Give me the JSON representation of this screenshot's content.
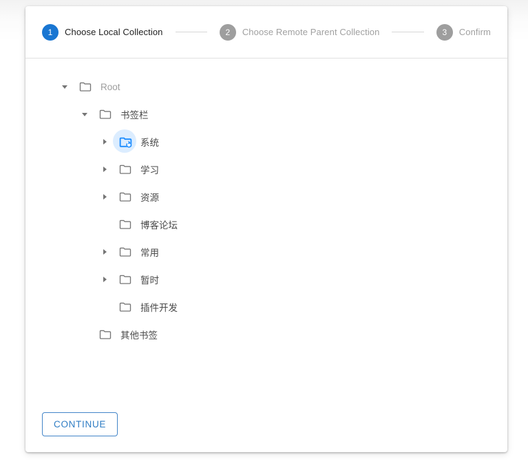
{
  "stepper": {
    "steps": [
      {
        "number": "1",
        "label": "Choose Local Collection",
        "state": "active"
      },
      {
        "number": "2",
        "label": "Choose Remote Parent Collection",
        "state": "inactive"
      },
      {
        "number": "3",
        "label": "Confirm",
        "state": "inactive"
      }
    ],
    "active_color": "#1976d2",
    "inactive_color": "#9e9e9e"
  },
  "tree": {
    "nodes": [
      {
        "label": "Root",
        "indent": 0,
        "toggle": "expanded",
        "muted": true,
        "selected": false
      },
      {
        "label": "书签栏",
        "indent": 1,
        "toggle": "expanded",
        "muted": false,
        "selected": false
      },
      {
        "label": "系统",
        "indent": 2,
        "toggle": "collapsed",
        "muted": false,
        "selected": true
      },
      {
        "label": "学习",
        "indent": 2,
        "toggle": "collapsed",
        "muted": false,
        "selected": false
      },
      {
        "label": "资源",
        "indent": 2,
        "toggle": "collapsed",
        "muted": false,
        "selected": false
      },
      {
        "label": "博客论坛",
        "indent": 2,
        "toggle": "none",
        "muted": false,
        "selected": false
      },
      {
        "label": "常用",
        "indent": 2,
        "toggle": "collapsed",
        "muted": false,
        "selected": false
      },
      {
        "label": "暂时",
        "indent": 2,
        "toggle": "collapsed",
        "muted": false,
        "selected": false
      },
      {
        "label": "插件开发",
        "indent": 2,
        "toggle": "none",
        "muted": false,
        "selected": false
      },
      {
        "label": "其他书签",
        "indent": 1,
        "toggle": "none",
        "muted": false,
        "selected": false
      }
    ],
    "selected_icon": "folder-sync-icon",
    "selected_color": "#1a8cff",
    "folder_icon": "folder-icon",
    "folder_color": "#757575"
  },
  "footer": {
    "continue_label": "CONTINUE",
    "continue_color": "#2f7dc4"
  }
}
